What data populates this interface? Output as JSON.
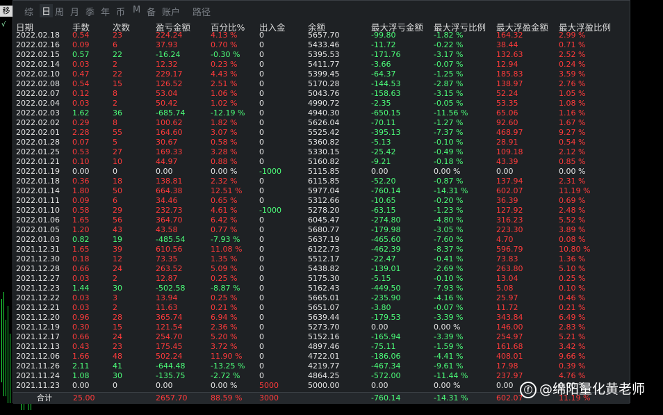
{
  "corner_label": "移",
  "toolbar": {
    "tabs": [
      {
        "label": "综",
        "active": false
      },
      {
        "label": "日",
        "active": true
      },
      {
        "label": "周",
        "active": false
      },
      {
        "label": "月",
        "active": false
      },
      {
        "label": "季",
        "active": false
      },
      {
        "label": "年",
        "active": false
      },
      {
        "label": "币",
        "active": false
      },
      {
        "label": "M",
        "active": false
      },
      {
        "label": "备",
        "active": false
      },
      {
        "label": "账户",
        "active": false
      },
      {
        "label": "路径",
        "active": false
      }
    ]
  },
  "table": {
    "columns": [
      "日期",
      "手数",
      "次数",
      "盈亏金额",
      "百分比%",
      "出入金",
      "余额",
      "最大浮亏金额",
      "最大浮亏比例",
      "最大浮盈金额",
      "最大浮盈比例"
    ],
    "rows": [
      [
        "2022.02.18",
        "0.54",
        "23",
        "224.24",
        "4.13 %",
        "0",
        "5657.70",
        "-99.80",
        "-1.82 %",
        "164.32",
        "2.99 %",
        "r"
      ],
      [
        "2022.02.16",
        "0.09",
        "6",
        "37.93",
        "0.70 %",
        "0",
        "5433.46",
        "-11.72",
        "-0.22 %",
        "38.44",
        "0.71 %",
        "r"
      ],
      [
        "2022.02.15",
        "0.57",
        "22",
        "-16.24",
        "-0.30 %",
        "0",
        "5395.53",
        "-171.76",
        "-3.17 %",
        "132.63",
        "2.52 %",
        "g"
      ],
      [
        "2022.02.14",
        "0.03",
        "2",
        "12.32",
        "0.23 %",
        "0",
        "5411.77",
        "-3.66",
        "-0.07 %",
        "12.94",
        "0.24 %",
        "r"
      ],
      [
        "2022.02.10",
        "0.47",
        "22",
        "229.17",
        "4.43 %",
        "0",
        "5399.45",
        "-64.37",
        "-1.25 %",
        "185.83",
        "3.59 %",
        "r"
      ],
      [
        "2022.02.08",
        "0.54",
        "15",
        "126.52",
        "2.51 %",
        "0",
        "5170.28",
        "-144.53",
        "-2.87 %",
        "138.97",
        "2.76 %",
        "r"
      ],
      [
        "2022.02.07",
        "0.12",
        "8",
        "53.04",
        "1.06 %",
        "0",
        "5043.76",
        "-158.63",
        "-3.15 %",
        "52.24",
        "1.05 %",
        "r"
      ],
      [
        "2022.02.04",
        "0.03",
        "2",
        "50.42",
        "1.02 %",
        "0",
        "4990.72",
        "-2.35",
        "-0.05 %",
        "53.35",
        "1.08 %",
        "r"
      ],
      [
        "2022.02.03",
        "1.62",
        "36",
        "-685.74",
        "-12.19 %",
        "0",
        "4940.30",
        "-650.15",
        "-11.56 %",
        "65.06",
        "1.16 %",
        "g"
      ],
      [
        "2022.02.02",
        "0.29",
        "8",
        "100.62",
        "1.82 %",
        "0",
        "5626.04",
        "-70.11",
        "-1.27 %",
        "92.60",
        "1.67 %",
        "r"
      ],
      [
        "2022.02.01",
        "2.28",
        "55",
        "164.60",
        "3.07 %",
        "0",
        "5525.42",
        "-395.13",
        "-7.37 %",
        "468.97",
        "9.27 %",
        "r"
      ],
      [
        "2022.01.28",
        "0.07",
        "5",
        "30.67",
        "0.58 %",
        "0",
        "5360.82",
        "-5.13",
        "-0.10 %",
        "28.91",
        "0.54 %",
        "r"
      ],
      [
        "2022.01.25",
        "0.53",
        "27",
        "169.33",
        "3.28 %",
        "0",
        "5330.15",
        "-25.42",
        "-0.49 %",
        "109.18",
        "2.12 %",
        "r"
      ],
      [
        "2022.01.21",
        "0.10",
        "10",
        "44.97",
        "0.88 %",
        "0",
        "5160.82",
        "-9.21",
        "-0.18 %",
        "43.39",
        "0.85 %",
        "r"
      ],
      [
        "2022.01.19",
        "0.00",
        "0",
        "0.00",
        "0.00 %",
        "-1000",
        "5115.85",
        "0.00",
        "0.00 %",
        "0.00",
        "0.00 %",
        "w"
      ],
      [
        "2022.01.18",
        "0.36",
        "18",
        "138.81",
        "2.32 %",
        "0",
        "6115.85",
        "-52.20",
        "-0.87 %",
        "137.94",
        "2.31 %",
        "r"
      ],
      [
        "2022.01.14",
        "1.80",
        "50",
        "664.38",
        "12.51 %",
        "0",
        "5977.04",
        "-760.14",
        "-14.31 %",
        "602.07",
        "11.19 %",
        "r"
      ],
      [
        "2022.01.11",
        "0.09",
        "6",
        "34.46",
        "0.65 %",
        "0",
        "5312.66",
        "-10.65",
        "-0.20 %",
        "36.39",
        "0.69 %",
        "r"
      ],
      [
        "2022.01.10",
        "0.58",
        "29",
        "232.73",
        "4.61 %",
        "-1000",
        "5278.20",
        "-63.15",
        "-1.23 %",
        "127.92",
        "2.48 %",
        "r"
      ],
      [
        "2022.01.06",
        "1.65",
        "56",
        "364.70",
        "6.42 %",
        "0",
        "6045.47",
        "-274.80",
        "-4.80 %",
        "316.23",
        "5.52 %",
        "r"
      ],
      [
        "2022.01.05",
        "1.20",
        "43",
        "43.58",
        "0.77 %",
        "0",
        "5680.77",
        "-179.98",
        "-3.05 %",
        "223.30",
        "3.89 %",
        "r"
      ],
      [
        "2022.01.03",
        "0.82",
        "19",
        "-485.54",
        "-7.93 %",
        "0",
        "5637.19",
        "-465.60",
        "-7.60 %",
        "4.70",
        "0.08 %",
        "g"
      ],
      [
        "2021.12.31",
        "1.65",
        "39",
        "610.56",
        "11.08 %",
        "0",
        "6122.73",
        "-462.39",
        "-8.37 %",
        "596.79",
        "10.80 %",
        "r"
      ],
      [
        "2021.12.30",
        "0.18",
        "12",
        "73.35",
        "1.35 %",
        "0",
        "5512.17",
        "-22.47",
        "-0.41 %",
        "73.83",
        "1.36 %",
        "r"
      ],
      [
        "2021.12.28",
        "0.66",
        "24",
        "263.52",
        "5.09 %",
        "0",
        "5438.82",
        "-139.01",
        "-2.69 %",
        "263.80",
        "5.10 %",
        "r"
      ],
      [
        "2021.12.27",
        "0.03",
        "2",
        "12.87",
        "0.25 %",
        "0",
        "5175.30",
        "-5.15",
        "-0.10 %",
        "13.04",
        "0.25 %",
        "r"
      ],
      [
        "2021.12.23",
        "1.44",
        "30",
        "-502.58",
        "-8.87 %",
        "0",
        "5162.43",
        "-449.50",
        "-7.93 %",
        "5.08",
        "0.10 %",
        "g"
      ],
      [
        "2021.12.22",
        "0.03",
        "3",
        "13.94",
        "0.25 %",
        "0",
        "5665.01",
        "-235.90",
        "-4.16 %",
        "25.97",
        "0.46 %",
        "r"
      ],
      [
        "2021.12.21",
        "0.03",
        "2",
        "11.63",
        "0.21 %",
        "0",
        "5651.07",
        "-3.80",
        "-0.07 %",
        "11.72",
        "0.21 %",
        "r"
      ],
      [
        "2021.12.20",
        "0.96",
        "28",
        "365.74",
        "6.94 %",
        "0",
        "5639.44",
        "-179.53",
        "-3.39 %",
        "343.84",
        "6.49 %",
        "r"
      ],
      [
        "2021.12.19",
        "0.30",
        "15",
        "121.54",
        "2.36 %",
        "0",
        "5273.70",
        "0.00",
        "0.00 %",
        "146.00",
        "2.83 %",
        "r"
      ],
      [
        "2021.12.17",
        "0.66",
        "24",
        "254.70",
        "5.20 %",
        "0",
        "5152.16",
        "-165.94",
        "-3.39 %",
        "254.97",
        "5.21 %",
        "r"
      ],
      [
        "2021.12.13",
        "0.43",
        "23",
        "175.45",
        "3.72 %",
        "0",
        "4897.46",
        "-75.11",
        "-1.59 %",
        "161.68",
        "3.42 %",
        "r"
      ],
      [
        "2021.12.06",
        "1.66",
        "48",
        "502.24",
        "11.90 %",
        "0",
        "4722.01",
        "-186.06",
        "-4.41 %",
        "408.01",
        "9.66 %",
        "r"
      ],
      [
        "2021.11.26",
        "2.11",
        "41",
        "-644.48",
        "-13.25 %",
        "0",
        "4219.77",
        "-467.34",
        "-9.61 %",
        "17.98",
        "0.39 %",
        "g"
      ],
      [
        "2021.11.24",
        "1.08",
        "30",
        "-135.75",
        "-2.72 %",
        "0",
        "4864.25",
        "-572.00",
        "-11.44 %",
        "237.97",
        "4.76 %",
        "g"
      ],
      [
        "2021.11.23",
        "0.00",
        "0",
        "0.00",
        "0.00 %",
        "5000",
        "5000.00",
        "0.00",
        "0.00 %",
        "0.00",
        "0.00 %",
        "w"
      ]
    ],
    "total": {
      "label": "合计",
      "lots": "25.00",
      "pnl": "2657.70",
      "pct": "88.59 %",
      "flow": "3000",
      "max_dd": "-760.14",
      "max_dd_pct": "-14.31 %",
      "max_profit": "602.07",
      "max_profit_pct": "11.19 %"
    }
  },
  "watermark": {
    "icon": "weibo-like-icon",
    "text": "@绵阳量化黄老师"
  },
  "colors": {
    "positive": "#ff3b3b",
    "negative": "#4cff7a",
    "neutral": "#e6e6e6",
    "background": "#1e2124"
  }
}
